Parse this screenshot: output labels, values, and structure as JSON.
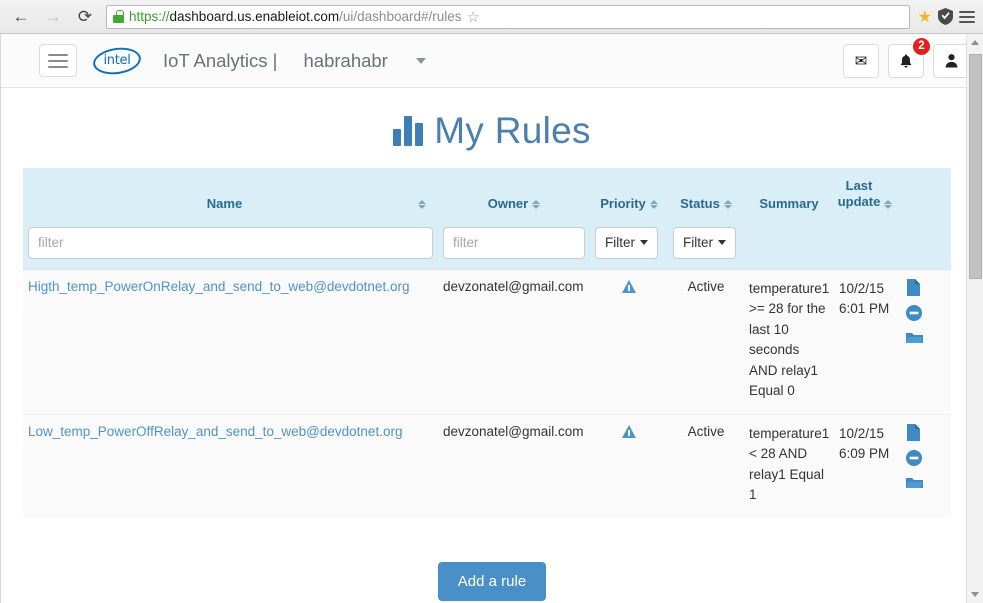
{
  "browser": {
    "back_icon": "←",
    "forward_icon": "→",
    "reload_icon": "⟳",
    "url_scheme": "https://",
    "url_host": "dashboard.us.enableiot.com",
    "url_path": "/ui/dashboard#/rules",
    "bookmark_icon": "☆",
    "pocket_icon": "★",
    "shield_icon": "shield-icon",
    "menu_icon": "hamburger-icon"
  },
  "app_header": {
    "menu_button": "hamburger-icon",
    "logo_text": "intel",
    "brand_title": "IoT Analytics |",
    "tenant": "habrahabr",
    "caret": "▾",
    "mail_icon": "✉",
    "bell_icon": "🔔",
    "bell_badge": "2",
    "user_icon": "👤"
  },
  "page": {
    "title": "My Rules",
    "title_icon": "bar-chart-icon"
  },
  "table": {
    "columns": [
      {
        "label": "Name",
        "sortable": true
      },
      {
        "label": "Owner",
        "sortable": true
      },
      {
        "label": "Priority",
        "sortable": true
      },
      {
        "label": "Status",
        "sortable": true
      },
      {
        "label": "Summary",
        "sortable": false
      },
      {
        "label": "Last update",
        "sortable": true
      }
    ],
    "filters": {
      "name_placeholder": "filter",
      "name_value": "",
      "owner_placeholder": "filter",
      "owner_value": "",
      "priority_button": "Filter",
      "status_button": "Filter"
    },
    "rows": [
      {
        "name": "Higth_temp_PowerOnRelay_and_send_to_web@devdotnet.org",
        "owner": "devzonatel@gmail.com",
        "priority": "warning-triangle-icon",
        "status": "Active",
        "summary": "temperature1 >= 28 for the last 10 seconds AND relay1 Equal 0",
        "last_update": "10/2/15 6:01 PM",
        "actions": [
          "document-icon",
          "disable-icon",
          "folder-icon"
        ]
      },
      {
        "name": "Low_temp_PowerOffRelay_and_send_to_web@devdotnet.org",
        "owner": "devzonatel@gmail.com",
        "priority": "warning-triangle-icon",
        "status": "Active",
        "summary": "temperature1 < 28 AND relay1 Equal 1",
        "last_update": "10/2/15 6:09 PM",
        "actions": [
          "document-icon",
          "disable-icon",
          "folder-icon"
        ]
      }
    ]
  },
  "footer": {
    "add_rule_label": "Add a rule"
  },
  "colors": {
    "accent": "#4a90c8",
    "header_bg": "#d9eef6",
    "link": "#4f93c9",
    "badge": "#e0231a",
    "intel_blue": "#0f6fba"
  }
}
